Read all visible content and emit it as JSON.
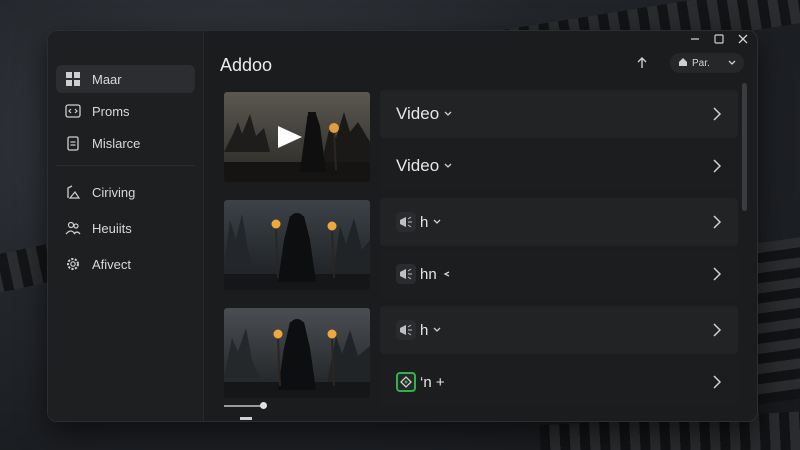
{
  "window": {
    "title": "Addoo"
  },
  "sidebar": {
    "items": [
      {
        "label": "Maar",
        "icon": "grid-icon",
        "active": true
      },
      {
        "label": "Proms",
        "icon": "code-window-icon",
        "active": false
      },
      {
        "label": "Mislarce",
        "icon": "clipboard-icon",
        "active": false
      }
    ],
    "items2": [
      {
        "label": "Ciriving",
        "icon": "gallery-icon"
      },
      {
        "label": "Heuiits",
        "icon": "people-icon"
      },
      {
        "label": "Afivect",
        "icon": "gear-icon"
      }
    ]
  },
  "header": {
    "sort_icon": "arrow-up-icon",
    "dropdown_label": "Par.",
    "dropdown_icon": "home-icon"
  },
  "groups": [
    {
      "rows": [
        {
          "label": "Video"
        },
        {
          "label": "Video"
        }
      ],
      "thumb_has_play": true
    },
    {
      "rows": [
        {
          "label": "h"
        },
        {
          "label": "hn"
        }
      ],
      "thumb_has_play": false
    },
    {
      "rows": [
        {
          "label": "h"
        },
        {
          "label": "‘n +"
        }
      ],
      "thumb_has_play": false
    }
  ],
  "colors": {
    "accent_green": "#31b247",
    "window_bg": "#1b1c1e"
  }
}
